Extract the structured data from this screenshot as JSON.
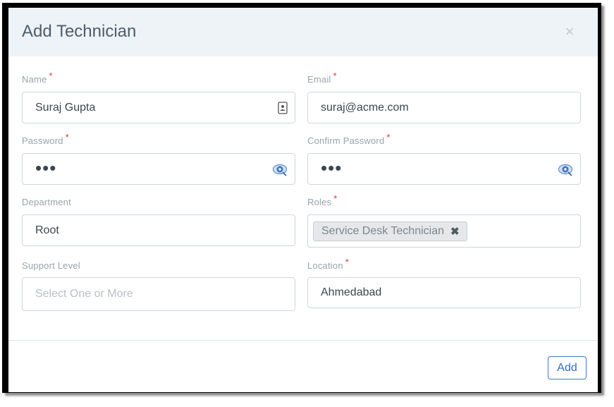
{
  "dialog": {
    "title": "Add Technician",
    "close_label": "×"
  },
  "form": {
    "name": {
      "label": "Name",
      "required_mark": "*",
      "value": "Suraj Gupta"
    },
    "email": {
      "label": "Email",
      "required_mark": "*",
      "value": "suraj@acme.com"
    },
    "password": {
      "label": "Password",
      "required_mark": "*",
      "value": "•••"
    },
    "confirm_password": {
      "label": "Confirm Password",
      "required_mark": "*",
      "value": "•••"
    },
    "department": {
      "label": "Department",
      "value": "Root"
    },
    "roles": {
      "label": "Roles",
      "required_mark": "*",
      "chips": [
        "Service Desk Technician"
      ],
      "chip_remove": "✖"
    },
    "support_level": {
      "label": "Support Level",
      "placeholder": "Select One or More"
    },
    "location": {
      "label": "Location",
      "required_mark": "*",
      "value": "Ahmedabad"
    }
  },
  "footer": {
    "add_label": "Add"
  },
  "colors": {
    "accent": "#2f6fc9",
    "required": "#e0353b",
    "header_bg": "#eef3f7"
  },
  "icons": {
    "name_field": "contact-card-icon",
    "password_field": "reveal-password-icon",
    "confirm_password_field": "reveal-password-icon"
  }
}
